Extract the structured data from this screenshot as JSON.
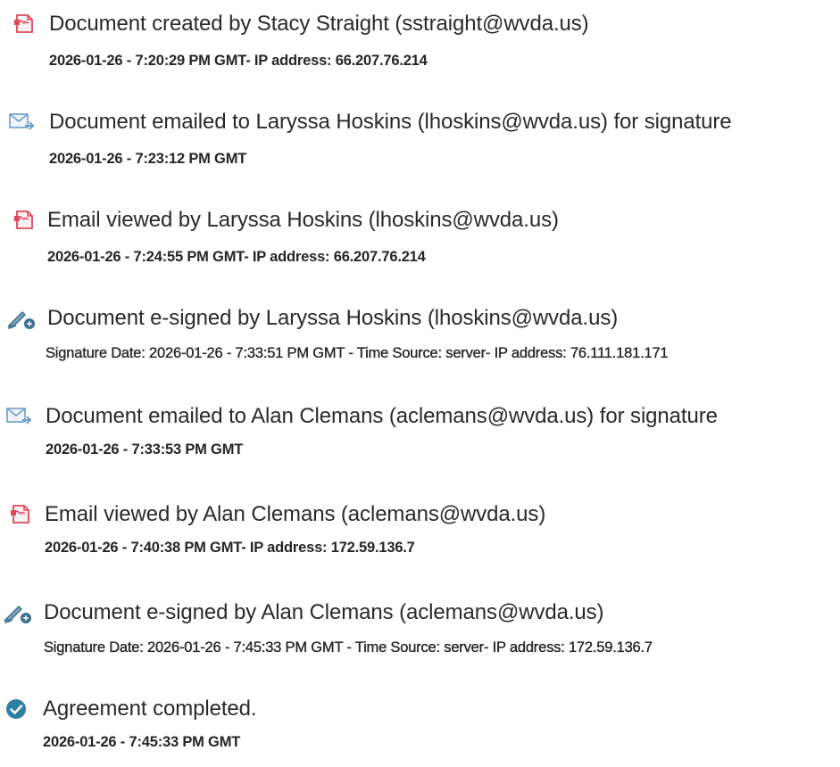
{
  "events": [
    {
      "icon": "document-icon",
      "title": "Document created by Stacy Straight (sstraight@wvda.us)",
      "detail": "2026-01-26 - 7:20:29 PM GMT- IP address: 66.207.76.214"
    },
    {
      "icon": "email-sent-icon",
      "title": "Document emailed to Laryssa Hoskins (lhoskins@wvda.us) for signature",
      "detail": "2026-01-26 - 7:23:12 PM GMT"
    },
    {
      "icon": "document-icon",
      "title": "Email viewed by Laryssa Hoskins (lhoskins@wvda.us)",
      "detail": "2026-01-26 - 7:24:55 PM GMT- IP address: 66.207.76.214"
    },
    {
      "icon": "e-sign-pen-icon",
      "title": "Document e-signed by Laryssa Hoskins (lhoskins@wvda.us)",
      "detail": "Signature Date: 2026-01-26 - 7:33:51 PM GMT - Time Source: server- IP address: 76.111.181.171"
    },
    {
      "icon": "email-sent-icon",
      "title": "Document emailed to Alan Clemans (aclemans@wvda.us) for signature",
      "detail": "2026-01-26 - 7:33:53 PM GMT"
    },
    {
      "icon": "document-icon",
      "title": "Email viewed by Alan Clemans (aclemans@wvda.us)",
      "detail": "2026-01-26 - 7:40:38 PM GMT- IP address: 172.59.136.7"
    },
    {
      "icon": "e-sign-pen-icon",
      "title": "Document e-signed by Alan Clemans (aclemans@wvda.us)",
      "detail": "Signature Date: 2026-01-26 - 7:45:33 PM GMT - Time Source: server- IP address: 172.59.136.7"
    },
    {
      "icon": "check-circle-icon",
      "title": "Agreement completed.",
      "detail": "2026-01-26 - 7:45:33 PM GMT"
    }
  ],
  "colors": {
    "document_icon": "#e0485a",
    "email_icon": "#6f9bc9",
    "pen_icon": "#3c6f8e",
    "check_icon": "#2f7fa3",
    "text": "#2a2a2a"
  }
}
